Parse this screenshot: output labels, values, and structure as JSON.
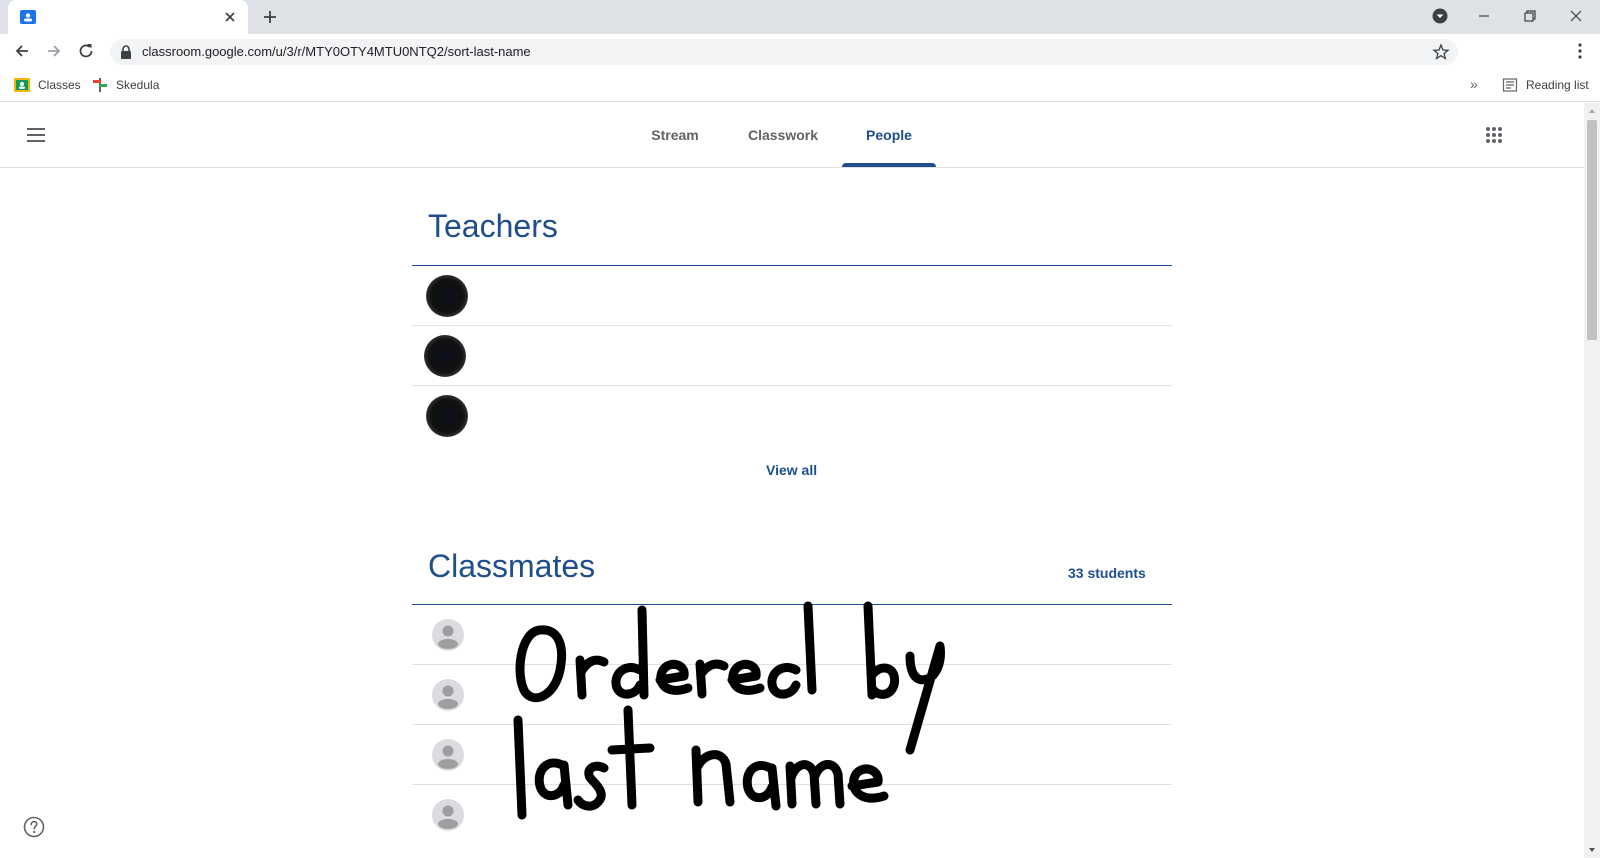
{
  "browser": {
    "url": "classroom.google.com/u/3/r/MTY0OTY4MTU0NTQ2/sort-last-name",
    "bookmarks": [
      {
        "label": "Classes",
        "icon": "classroom-icon"
      },
      {
        "label": "Skedula",
        "icon": "skedula-icon"
      }
    ],
    "reading_list_label": "Reading list",
    "more_bookmarks_label": "»"
  },
  "header": {
    "tabs": [
      {
        "label": "Stream",
        "active": false
      },
      {
        "label": "Classwork",
        "active": false
      },
      {
        "label": "People",
        "active": true
      }
    ]
  },
  "teachers": {
    "title": "Teachers",
    "view_all_label": "View all",
    "rows": 3
  },
  "classmates": {
    "title": "Classmates",
    "count_label": "33 students",
    "rows": 4
  },
  "annotation": {
    "handwritten_text": "Ordered by last name"
  },
  "colors": {
    "accent": "#1e4e8c",
    "divider": "#e0e0e0",
    "muted": "#5f6368"
  }
}
